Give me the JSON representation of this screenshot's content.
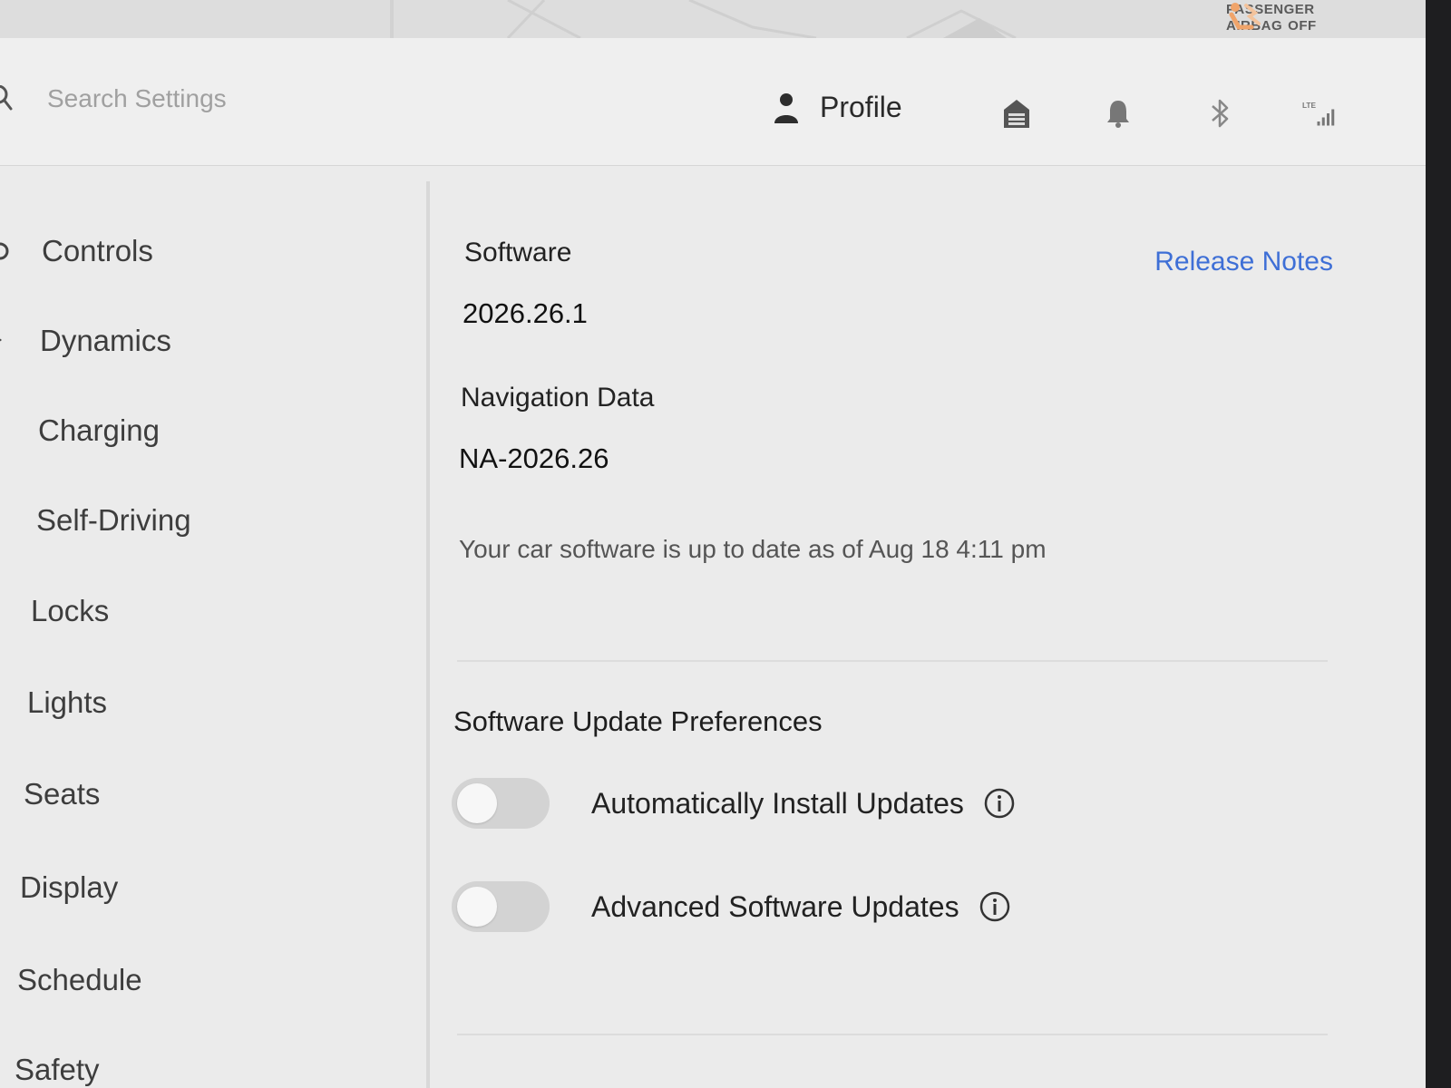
{
  "airbag": {
    "line1": "PASSENGER",
    "line2": "AIRBAG",
    "state": "OFF"
  },
  "search": {
    "placeholder": "Search Settings"
  },
  "header": {
    "profile_label": "Profile",
    "icons": [
      "garage-icon",
      "bell-icon",
      "bluetooth-icon",
      "lte-signal-icon"
    ],
    "lte_label": "LTE"
  },
  "sidebar": {
    "items": [
      {
        "label": "Controls",
        "icon": "car-icon"
      },
      {
        "label": "Dynamics",
        "icon": "dynamics-icon"
      },
      {
        "label": "Charging",
        "icon": "bolt-icon"
      },
      {
        "label": "Self-Driving",
        "icon": "steering-icon"
      },
      {
        "label": "Locks",
        "icon": ""
      },
      {
        "label": "Lights",
        "icon": ""
      },
      {
        "label": "Seats",
        "icon": ""
      },
      {
        "label": "Display",
        "icon": ""
      },
      {
        "label": "Schedule",
        "icon": ""
      },
      {
        "label": "Safety",
        "icon": ""
      }
    ]
  },
  "software": {
    "label": "Software",
    "version": "2026.26.1",
    "release_notes": "Release Notes",
    "nav_label": "Navigation Data",
    "nav_version": "NA-2026.26",
    "status": "Your car software is up to date as of Aug 18 4:11 pm"
  },
  "preferences": {
    "title": "Software Update Preferences",
    "toggles": [
      {
        "label": "Automatically Install Updates",
        "on": false
      },
      {
        "label": "Advanced Software Updates",
        "on": false
      }
    ]
  },
  "colors": {
    "accent": "#3e6fd6",
    "background": "#ebebeb",
    "airbag_icon": "#f0a46a"
  }
}
